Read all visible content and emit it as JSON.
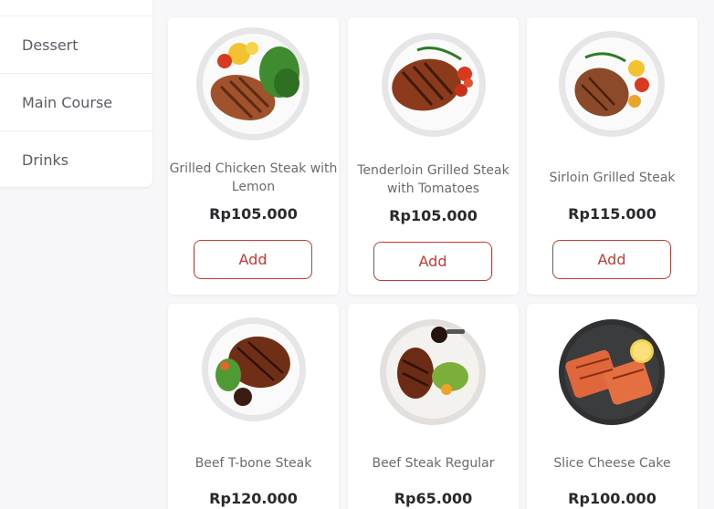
{
  "sidebar": {
    "items": [
      {
        "label": "Dessert"
      },
      {
        "label": "Main Course"
      },
      {
        "label": "Drinks"
      }
    ]
  },
  "products": [
    {
      "name": "Grilled Chicken Steak with Lemon",
      "price": "Rp105.000",
      "add_label": "Add"
    },
    {
      "name": "Tenderloin Grilled Steak with Tomatoes",
      "price": "Rp105.000",
      "add_label": "Add"
    },
    {
      "name": "Sirloin Grilled Steak",
      "price": "Rp115.000",
      "add_label": "Add"
    },
    {
      "name": "Beef T-bone Steak",
      "price": "Rp120.000"
    },
    {
      "name": "Beef Steak Regular",
      "price": "Rp65.000"
    },
    {
      "name": "Slice Cheese Cake",
      "price": "Rp100.000"
    }
  ],
  "colors": {
    "accent": "#c53a32",
    "background": "#f7f6f8",
    "card": "#ffffff"
  }
}
